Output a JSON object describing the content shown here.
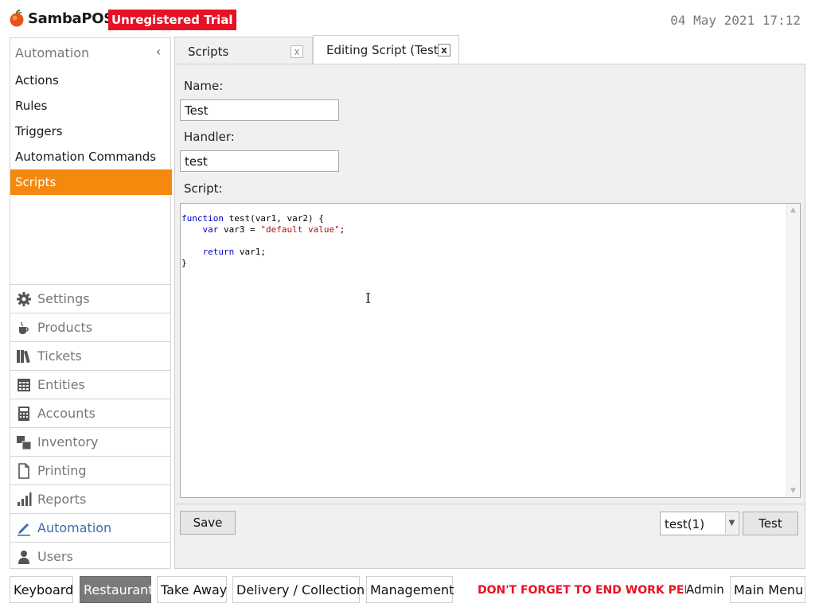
{
  "header": {
    "brand": "SambaPOS",
    "trial_badge": "Unregistered Trial",
    "datetime": "04 May 2021 17:12",
    "accent_color": "#e81123"
  },
  "sidebar": {
    "title": "Automation",
    "collapse_glyph": "‹",
    "items": [
      {
        "label": "Actions"
      },
      {
        "label": "Rules"
      },
      {
        "label": "Triggers"
      },
      {
        "label": "Automation Commands"
      },
      {
        "label": "Scripts",
        "active": true
      }
    ],
    "active_color": "#f5890e",
    "modules": [
      {
        "label": "Settings",
        "icon": "gear-icon"
      },
      {
        "label": "Products",
        "icon": "cup-icon"
      },
      {
        "label": "Tickets",
        "icon": "books-icon"
      },
      {
        "label": "Entities",
        "icon": "table-icon"
      },
      {
        "label": "Accounts",
        "icon": "calculator-icon"
      },
      {
        "label": "Inventory",
        "icon": "boxes-icon"
      },
      {
        "label": "Printing",
        "icon": "document-icon"
      },
      {
        "label": "Reports",
        "icon": "bar-chart-icon"
      },
      {
        "label": "Automation",
        "icon": "pen-icon",
        "active": true
      },
      {
        "label": "Users",
        "icon": "user-icon"
      }
    ]
  },
  "tabs": [
    {
      "label": "Scripts",
      "close": "x"
    },
    {
      "label": "Editing Script (Test)",
      "close": "x",
      "active": true
    }
  ],
  "form": {
    "name_label": "Name:",
    "name_value": "Test",
    "handler_label": "Handler:",
    "handler_value": "test",
    "script_label": "Script:",
    "code": {
      "l1_kw": "function",
      "l1_rest": " test(var1, var2) {",
      "l2_indent": "    ",
      "l2_kw": "var",
      "l2_mid": " var3 = ",
      "l2_str": "\"default value\"",
      "l2_end": ";",
      "l4_indent": "    ",
      "l4_kw": "return",
      "l4_rest": " var1;",
      "l5": "}"
    },
    "save_label": "Save",
    "test_select_value": "test(1)",
    "test_label": "Test"
  },
  "footer": {
    "buttons": [
      {
        "label": "Keyboard"
      },
      {
        "label": "Restaurant",
        "active": true
      },
      {
        "label": "Take Away"
      },
      {
        "label": "Delivery / Collection"
      },
      {
        "label": "Management"
      }
    ],
    "warning": "DON'T FORGET TO END WORK PERIOD",
    "user": "Admin",
    "main_menu": "Main Menu"
  }
}
